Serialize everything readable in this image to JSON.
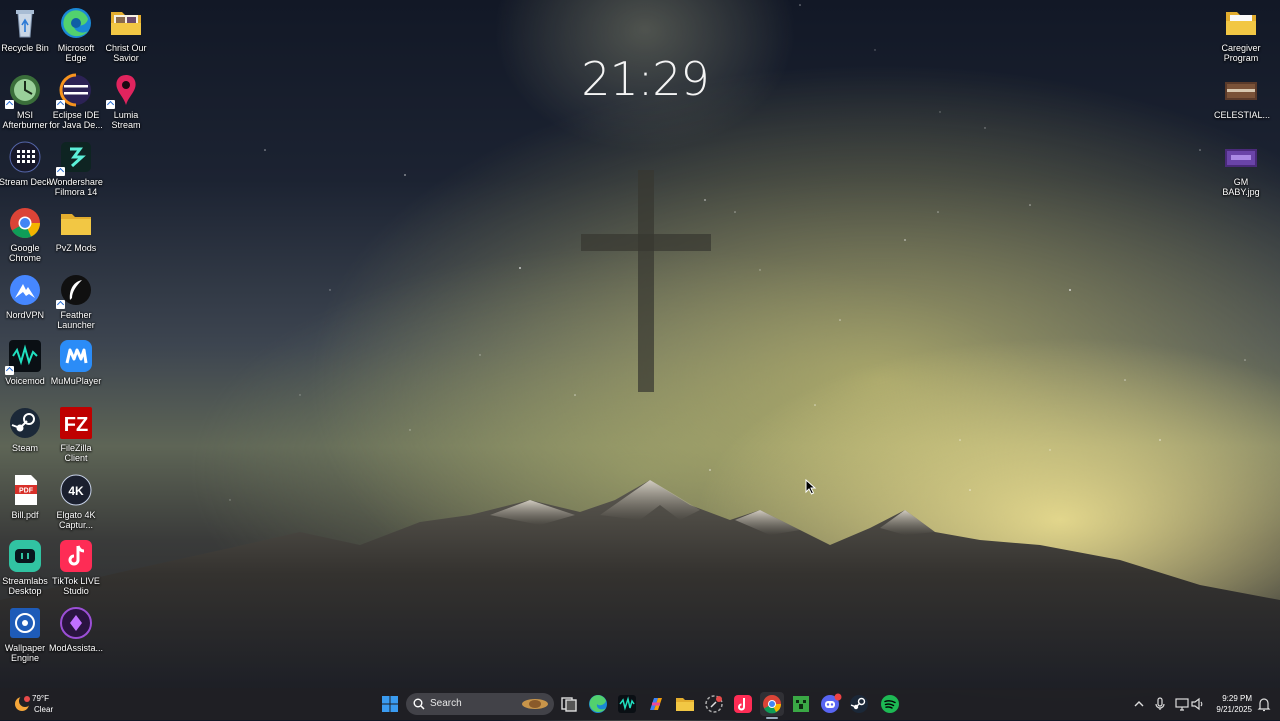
{
  "wallpaper": {
    "clock": "21:29"
  },
  "desktop_icons": {
    "recycle_bin": "Recycle Bin",
    "edge": "Microsoft\nEdge",
    "christ": "Christ Our\nSavior",
    "msi": "MSI\nAfterburner",
    "eclipse": "Eclipse IDE\nfor Java De...",
    "lumia": "Lumia\nStream",
    "streamdeck": "Stream Deck",
    "filmora": "Wondershare\nFilmora 14",
    "chrome": "Google\nChrome",
    "pvz": "PvZ Mods",
    "nordvpn": "NordVPN",
    "feather": "Feather\nLauncher",
    "voicemod": "Voicemod",
    "mumu": "MuMuPlayer",
    "steam": "Steam",
    "filezilla": "FileZilla\nClient",
    "bill": "Bill.pdf",
    "elgato": "Elgato 4K\nCaptur...",
    "streamlabs": "Streamlabs\nDesktop",
    "tiktok": "TikTok LIVE\nStudio",
    "wallpaper_engine": "Wallpaper\nEngine",
    "modassist": "ModAssista...",
    "caregiver": "Caregiver\nProgram",
    "celestial": "CELESTIAL...",
    "gmbaby": "GM BABY.jpg"
  },
  "taskbar": {
    "weather_temp": "79°F",
    "weather_desc": "Clear",
    "search_placeholder": "Search",
    "time": "9:29 PM",
    "date": "9/21/2025"
  },
  "colors": {
    "taskbar_bg": "#202024",
    "folder_yellow": "#f2c744",
    "chrome_red": "#db4437",
    "edge_blue": "#1a88d6",
    "spotify_green": "#1db954"
  }
}
